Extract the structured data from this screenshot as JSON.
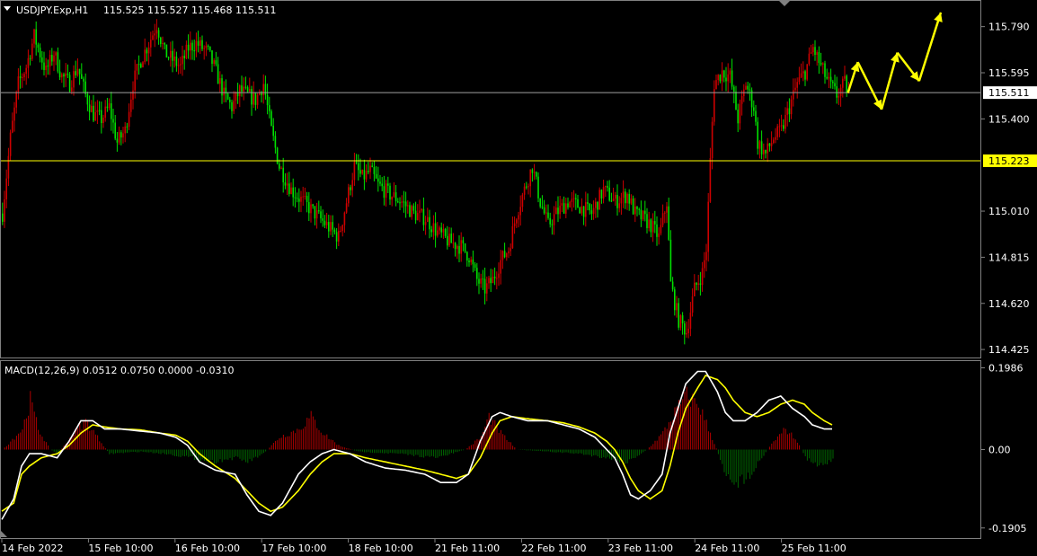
{
  "chart_data": [
    {
      "type": "candlestick",
      "symbol_header": "USDJPY.Exp,H1",
      "ohlc_header": "115.525 115.527 115.468 115.511",
      "y_ticks": [
        "115.790",
        "115.595",
        "115.400",
        "115.010",
        "114.815",
        "114.620",
        "114.425"
      ],
      "ylim": [
        114.395,
        115.895
      ],
      "current_price": 115.511,
      "current_price_label": "115.511",
      "horizontal_level": 115.223,
      "horizontal_level_label": "115.223",
      "x_tick_labels": [
        "14 Feb 2022",
        "15 Feb 10:00",
        "16 Feb 10:00",
        "17 Feb 10:00",
        "18 Feb 10:00",
        "21 Feb 11:00",
        "22 Feb 11:00",
        "23 Feb 11:00",
        "24 Feb 11:00",
        "25 Feb 11:00"
      ],
      "close_path": [
        [
          0,
          115.0
        ],
        [
          4,
          115.32
        ],
        [
          8,
          115.55
        ],
        [
          12,
          115.62
        ],
        [
          16,
          115.75
        ],
        [
          22,
          115.6
        ],
        [
          26,
          115.68
        ],
        [
          30,
          115.58
        ],
        [
          34,
          115.55
        ],
        [
          38,
          115.62
        ],
        [
          42,
          115.5
        ],
        [
          46,
          115.42
        ],
        [
          50,
          115.4
        ],
        [
          54,
          115.45
        ],
        [
          58,
          115.3
        ],
        [
          62,
          115.35
        ],
        [
          66,
          115.55
        ],
        [
          70,
          115.65
        ],
        [
          74,
          115.72
        ],
        [
          78,
          115.8
        ],
        [
          82,
          115.68
        ],
        [
          86,
          115.65
        ],
        [
          90,
          115.62
        ],
        [
          94,
          115.7
        ],
        [
          98,
          115.72
        ],
        [
          104,
          115.68
        ],
        [
          108,
          115.6
        ],
        [
          112,
          115.5
        ],
        [
          116,
          115.45
        ],
        [
          120,
          115.52
        ],
        [
          124,
          115.5
        ],
        [
          128,
          115.48
        ],
        [
          132,
          115.55
        ],
        [
          136,
          115.35
        ],
        [
          140,
          115.2
        ],
        [
          146,
          115.1
        ],
        [
          152,
          115.05
        ],
        [
          158,
          115.0
        ],
        [
          164,
          114.95
        ],
        [
          170,
          114.9
        ],
        [
          174,
          115.05
        ],
        [
          178,
          115.2
        ],
        [
          182,
          115.15
        ],
        [
          186,
          115.18
        ],
        [
          190,
          115.12
        ],
        [
          196,
          115.08
        ],
        [
          202,
          115.05
        ],
        [
          208,
          115.0
        ],
        [
          214,
          114.98
        ],
        [
          220,
          114.92
        ],
        [
          226,
          114.88
        ],
        [
          232,
          114.86
        ],
        [
          236,
          114.82
        ],
        [
          240,
          114.72
        ],
        [
          244,
          114.68
        ],
        [
          248,
          114.72
        ],
        [
          252,
          114.8
        ],
        [
          256,
          114.85
        ],
        [
          260,
          115.0
        ],
        [
          264,
          115.1
        ],
        [
          268,
          115.2
        ],
        [
          272,
          115.05
        ],
        [
          276,
          114.95
        ],
        [
          280,
          115.0
        ],
        [
          286,
          115.05
        ],
        [
          292,
          115.03
        ],
        [
          298,
          115.0
        ],
        [
          304,
          115.1
        ],
        [
          310,
          115.05
        ],
        [
          316,
          115.08
        ],
        [
          320,
          115.0
        ],
        [
          324,
          114.98
        ],
        [
          328,
          114.95
        ],
        [
          332,
          114.9
        ],
        [
          336,
          115.05
        ],
        [
          338,
          114.7
        ],
        [
          342,
          114.55
        ],
        [
          346,
          114.5
        ],
        [
          350,
          114.68
        ],
        [
          354,
          114.75
        ],
        [
          356,
          114.85
        ],
        [
          358,
          115.22
        ],
        [
          360,
          115.55
        ],
        [
          364,
          115.6
        ],
        [
          368,
          115.58
        ],
        [
          372,
          115.4
        ],
        [
          376,
          115.55
        ],
        [
          380,
          115.45
        ],
        [
          382,
          115.3
        ],
        [
          386,
          115.25
        ],
        [
          390,
          115.32
        ],
        [
          394,
          115.35
        ],
        [
          398,
          115.45
        ],
        [
          402,
          115.55
        ],
        [
          406,
          115.6
        ],
        [
          410,
          115.7
        ],
        [
          414,
          115.62
        ],
        [
          418,
          115.55
        ],
        [
          422,
          115.5
        ],
        [
          426,
          115.55
        ],
        [
          428,
          115.51
        ]
      ],
      "forecast_path": [
        [
          428,
          115.51
        ],
        [
          433,
          115.64
        ],
        [
          445,
          115.44
        ],
        [
          453,
          115.68
        ],
        [
          464,
          115.56
        ],
        [
          475,
          115.85
        ]
      ],
      "colors": {
        "bull": "#cc0000",
        "bear": "#00e000",
        "level": "#ffff00",
        "price_line": "#a0a0a0",
        "forecast": "#ffff00"
      }
    },
    {
      "type": "macd",
      "header": "MACD(12,26,9) 0.0512 0.0750 0.0000 -0.0310",
      "y_ticks": [
        "0.1986",
        "0.00",
        "-0.1905"
      ],
      "ylim": [
        -0.215,
        0.215
      ],
      "zero_value": 0.0,
      "macd_path": [
        [
          0,
          -0.17
        ],
        [
          6,
          -0.12
        ],
        [
          10,
          -0.04
        ],
        [
          14,
          -0.01
        ],
        [
          20,
          -0.01
        ],
        [
          28,
          -0.02
        ],
        [
          34,
          0.02
        ],
        [
          40,
          0.07
        ],
        [
          46,
          0.07
        ],
        [
          52,
          0.05
        ],
        [
          60,
          0.05
        ],
        [
          70,
          0.045
        ],
        [
          80,
          0.04
        ],
        [
          88,
          0.03
        ],
        [
          94,
          0.01
        ],
        [
          100,
          -0.03
        ],
        [
          108,
          -0.05
        ],
        [
          118,
          -0.06
        ],
        [
          124,
          -0.11
        ],
        [
          130,
          -0.15
        ],
        [
          136,
          -0.16
        ],
        [
          142,
          -0.13
        ],
        [
          150,
          -0.06
        ],
        [
          156,
          -0.03
        ],
        [
          162,
          -0.01
        ],
        [
          168,
          0.0
        ],
        [
          176,
          -0.01
        ],
        [
          184,
          -0.03
        ],
        [
          194,
          -0.045
        ],
        [
          204,
          -0.05
        ],
        [
          214,
          -0.06
        ],
        [
          222,
          -0.08
        ],
        [
          230,
          -0.08
        ],
        [
          236,
          -0.06
        ],
        [
          242,
          0.02
        ],
        [
          248,
          0.08
        ],
        [
          252,
          0.09
        ],
        [
          258,
          0.08
        ],
        [
          266,
          0.07
        ],
        [
          276,
          0.07
        ],
        [
          284,
          0.06
        ],
        [
          292,
          0.05
        ],
        [
          300,
          0.03
        ],
        [
          306,
          0.0
        ],
        [
          310,
          -0.02
        ],
        [
          314,
          -0.06
        ],
        [
          318,
          -0.11
        ],
        [
          322,
          -0.12
        ],
        [
          328,
          -0.1
        ],
        [
          334,
          -0.06
        ],
        [
          338,
          0.04
        ],
        [
          342,
          0.1
        ],
        [
          346,
          0.16
        ],
        [
          352,
          0.19
        ],
        [
          356,
          0.19
        ],
        [
          362,
          0.14
        ],
        [
          366,
          0.09
        ],
        [
          370,
          0.07
        ],
        [
          376,
          0.07
        ],
        [
          382,
          0.09
        ],
        [
          388,
          0.12
        ],
        [
          394,
          0.13
        ],
        [
          400,
          0.1
        ],
        [
          406,
          0.08
        ],
        [
          410,
          0.06
        ],
        [
          416,
          0.05
        ],
        [
          420,
          0.05
        ]
      ],
      "signal_path": [
        [
          0,
          -0.15
        ],
        [
          6,
          -0.13
        ],
        [
          10,
          -0.06
        ],
        [
          14,
          -0.04
        ],
        [
          20,
          -0.02
        ],
        [
          28,
          -0.01
        ],
        [
          34,
          0.01
        ],
        [
          40,
          0.04
        ],
        [
          46,
          0.06
        ],
        [
          52,
          0.055
        ],
        [
          60,
          0.05
        ],
        [
          70,
          0.048
        ],
        [
          80,
          0.04
        ],
        [
          88,
          0.035
        ],
        [
          94,
          0.02
        ],
        [
          100,
          -0.01
        ],
        [
          108,
          -0.04
        ],
        [
          118,
          -0.07
        ],
        [
          124,
          -0.1
        ],
        [
          130,
          -0.13
        ],
        [
          136,
          -0.15
        ],
        [
          142,
          -0.14
        ],
        [
          150,
          -0.1
        ],
        [
          156,
          -0.06
        ],
        [
          162,
          -0.03
        ],
        [
          168,
          -0.01
        ],
        [
          176,
          -0.01
        ],
        [
          184,
          -0.02
        ],
        [
          194,
          -0.03
        ],
        [
          204,
          -0.04
        ],
        [
          214,
          -0.05
        ],
        [
          222,
          -0.06
        ],
        [
          230,
          -0.07
        ],
        [
          236,
          -0.06
        ],
        [
          242,
          -0.02
        ],
        [
          248,
          0.04
        ],
        [
          252,
          0.07
        ],
        [
          258,
          0.08
        ],
        [
          266,
          0.075
        ],
        [
          276,
          0.07
        ],
        [
          284,
          0.065
        ],
        [
          292,
          0.055
        ],
        [
          300,
          0.04
        ],
        [
          306,
          0.02
        ],
        [
          310,
          0.0
        ],
        [
          314,
          -0.03
        ],
        [
          318,
          -0.07
        ],
        [
          322,
          -0.1
        ],
        [
          328,
          -0.12
        ],
        [
          334,
          -0.1
        ],
        [
          338,
          -0.04
        ],
        [
          342,
          0.04
        ],
        [
          346,
          0.1
        ],
        [
          352,
          0.15
        ],
        [
          356,
          0.18
        ],
        [
          362,
          0.17
        ],
        [
          366,
          0.15
        ],
        [
          370,
          0.12
        ],
        [
          376,
          0.09
        ],
        [
          382,
          0.08
        ],
        [
          388,
          0.09
        ],
        [
          394,
          0.11
        ],
        [
          400,
          0.12
        ],
        [
          406,
          0.11
        ],
        [
          410,
          0.09
        ],
        [
          416,
          0.07
        ],
        [
          420,
          0.06
        ]
      ],
      "hist_profile": [
        [
          0,
          0.0
        ],
        [
          10,
          0.05
        ],
        [
          14,
          0.12
        ],
        [
          18,
          0.05
        ],
        [
          24,
          0.0
        ],
        [
          28,
          -0.01
        ],
        [
          36,
          0.04
        ],
        [
          42,
          0.07
        ],
        [
          48,
          0.03
        ],
        [
          54,
          -0.01
        ],
        [
          70,
          -0.005
        ],
        [
          82,
          -0.01
        ],
        [
          96,
          -0.02
        ],
        [
          106,
          -0.03
        ],
        [
          118,
          -0.02
        ],
        [
          124,
          -0.03
        ],
        [
          132,
          -0.01
        ],
        [
          140,
          0.03
        ],
        [
          150,
          0.05
        ],
        [
          156,
          0.08
        ],
        [
          162,
          0.04
        ],
        [
          170,
          0.01
        ],
        [
          180,
          -0.005
        ],
        [
          200,
          -0.01
        ],
        [
          220,
          -0.02
        ],
        [
          234,
          0.0
        ],
        [
          242,
          0.03
        ],
        [
          246,
          0.08
        ],
        [
          252,
          0.04
        ],
        [
          260,
          0.0
        ],
        [
          276,
          -0.005
        ],
        [
          292,
          -0.01
        ],
        [
          306,
          -0.02
        ],
        [
          316,
          -0.03
        ],
        [
          326,
          0.0
        ],
        [
          334,
          0.04
        ],
        [
          340,
          0.09
        ],
        [
          346,
          0.13
        ],
        [
          352,
          0.11
        ],
        [
          358,
          0.04
        ],
        [
          362,
          -0.01
        ],
        [
          366,
          -0.06
        ],
        [
          372,
          -0.08
        ],
        [
          378,
          -0.06
        ],
        [
          384,
          -0.02
        ],
        [
          390,
          0.02
        ],
        [
          396,
          0.05
        ],
        [
          402,
          0.02
        ],
        [
          406,
          -0.02
        ],
        [
          412,
          -0.04
        ],
        [
          418,
          -0.03
        ],
        [
          420,
          -0.02
        ]
      ],
      "colors": {
        "macd": "#ffffff",
        "signal": "#ffff00",
        "hist_pos": "#b00000",
        "hist_neg": "#006600"
      }
    }
  ]
}
